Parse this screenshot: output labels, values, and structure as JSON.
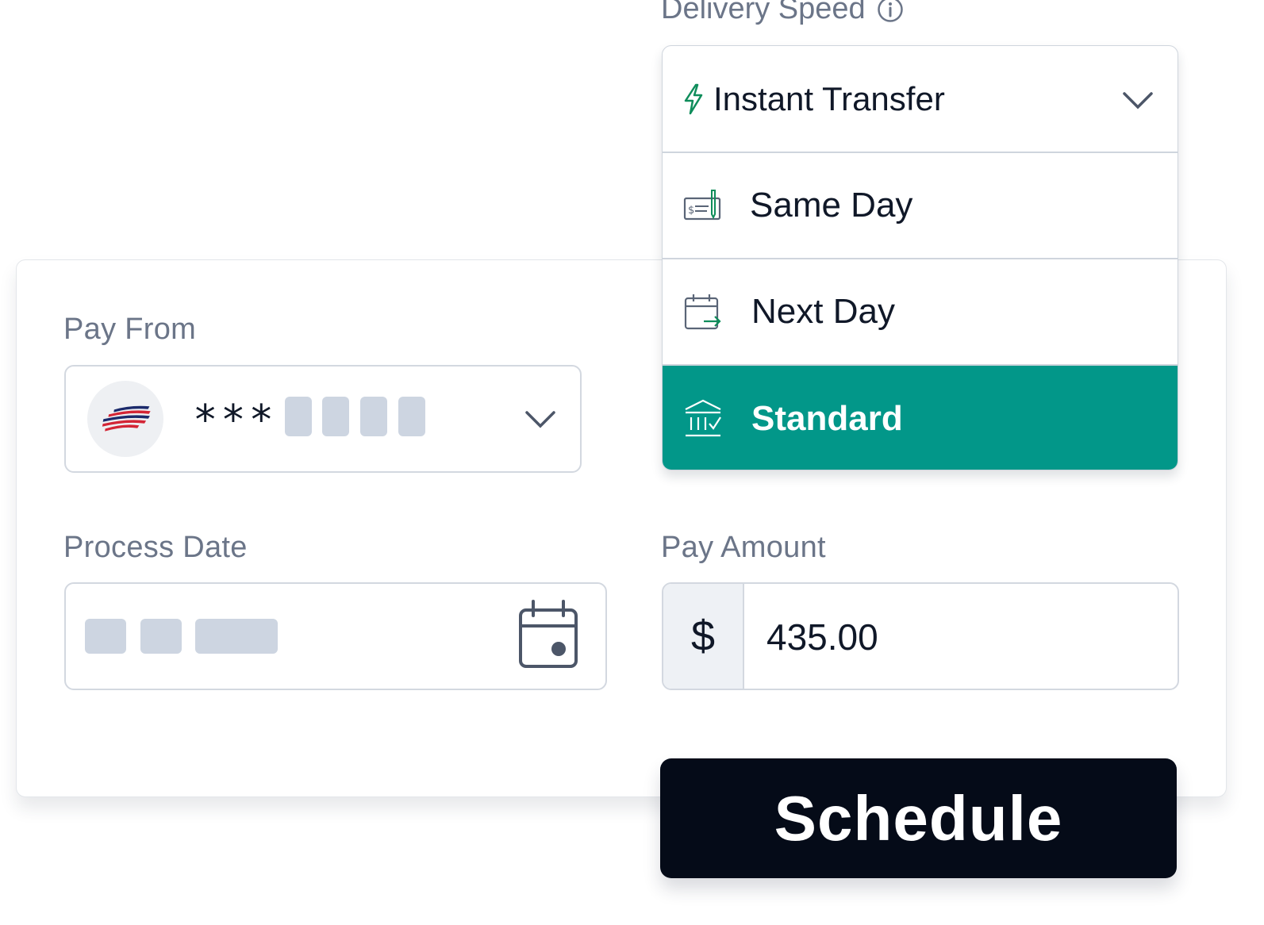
{
  "delivery_speed": {
    "label": "Delivery Speed",
    "selected_option": "Instant Transfer",
    "options": [
      {
        "label": "Same Day",
        "icon": "check-icon"
      },
      {
        "label": "Next Day",
        "icon": "calendar-arrow-icon"
      },
      {
        "label": "Standard",
        "icon": "bank-icon",
        "selected": true
      }
    ],
    "selected_icon": "lightning-icon",
    "accent_color": "#029789"
  },
  "pay_from": {
    "label": "Pay From",
    "masked_prefix": "***",
    "bank_icon": "bank-logo-icon"
  },
  "process_date": {
    "label": "Process Date",
    "icon": "calendar-icon"
  },
  "pay_amount": {
    "label": "Pay Amount",
    "currency": "$",
    "value": "435.00"
  },
  "schedule_button": {
    "label": "Schedule",
    "color": "#050b18"
  }
}
